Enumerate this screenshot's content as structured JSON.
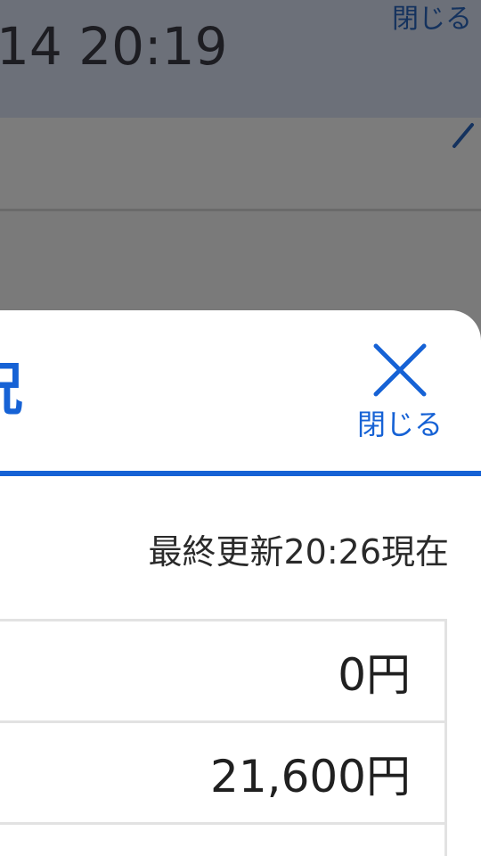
{
  "background_page": {
    "datetime_text": "14 20:19",
    "close_label": "閉じる"
  },
  "modal": {
    "title_fragment": "況",
    "close_button": {
      "label": "閉じる",
      "icon": "close-x-icon"
    },
    "last_updated": "最終更新20:26現在",
    "amounts": [
      {
        "value": "0円"
      },
      {
        "value": "21,600円"
      },
      {
        "value": ""
      }
    ]
  },
  "colors": {
    "accent": "#1662d5",
    "overlay": "#7a7a7a",
    "text": "#202020",
    "border": "#e2e2e2"
  }
}
